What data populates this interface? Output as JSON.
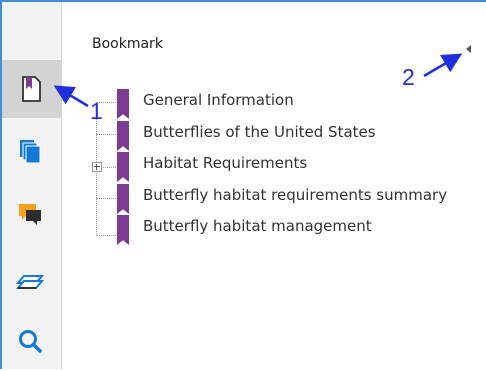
{
  "panel": {
    "title": "Bookmark"
  },
  "sidebar": {
    "buttons": [
      {
        "name": "bookmark-panel-button",
        "icon": "page-icon",
        "active": true
      },
      {
        "name": "pages-panel-button",
        "icon": "stacked-pages-icon"
      },
      {
        "name": "comments-panel-button",
        "icon": "comment-icon"
      },
      {
        "name": "layers-panel-button",
        "icon": "layers-icon"
      },
      {
        "name": "search-panel-button",
        "icon": "search-icon"
      }
    ]
  },
  "bookmarks": [
    {
      "label": "General Information",
      "expandable": false
    },
    {
      "label": "Butterflies of the United States",
      "expandable": false
    },
    {
      "label": "Habitat Requirements",
      "expandable": true
    },
    {
      "label": "Butterfly habitat requirements summary",
      "expandable": false
    },
    {
      "label": "Butterfly habitat management",
      "expandable": false
    }
  ],
  "annotations": [
    {
      "number": "1"
    },
    {
      "number": "2"
    }
  ],
  "colors": {
    "bookmark_ribbon": "#7e3b93",
    "accent_blue": "#1479d6",
    "annotation_blue": "#1f2fe0",
    "comment_orange": "#f3a21b"
  }
}
